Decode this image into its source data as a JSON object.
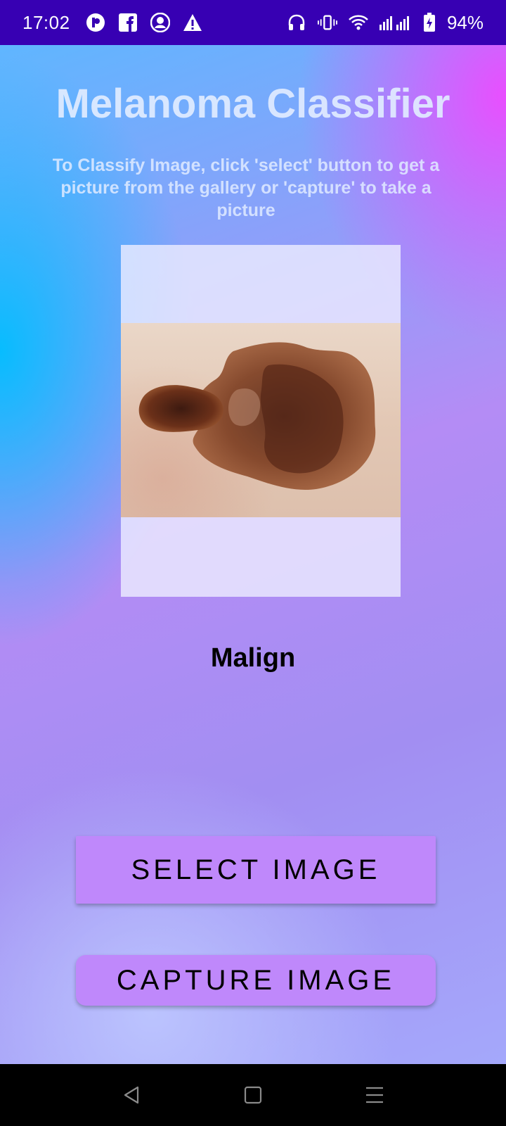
{
  "status_bar": {
    "time": "17:02",
    "left_icons": [
      "app-notification-icon",
      "facebook-icon",
      "contact-badge-icon",
      "warning-icon"
    ],
    "right_icons": [
      "headset-icon",
      "vibrate-icon",
      "wifi-icon",
      "signal-icon",
      "battery-charging-icon"
    ],
    "battery": "94%",
    "background_color": "#3700b3"
  },
  "app": {
    "title": "Melanoma Classifier",
    "instructions": "To Classify Image, click 'select' button to get a picture from the gallery or 'capture' to take a picture",
    "result": "Malign",
    "select_button": "SELECT IMAGE",
    "capture_button": "CAPTURE IMAGE",
    "button_color": "#bf88fb"
  },
  "nav_bar": {
    "buttons": [
      "back-icon",
      "home-icon",
      "menu-icon"
    ]
  }
}
